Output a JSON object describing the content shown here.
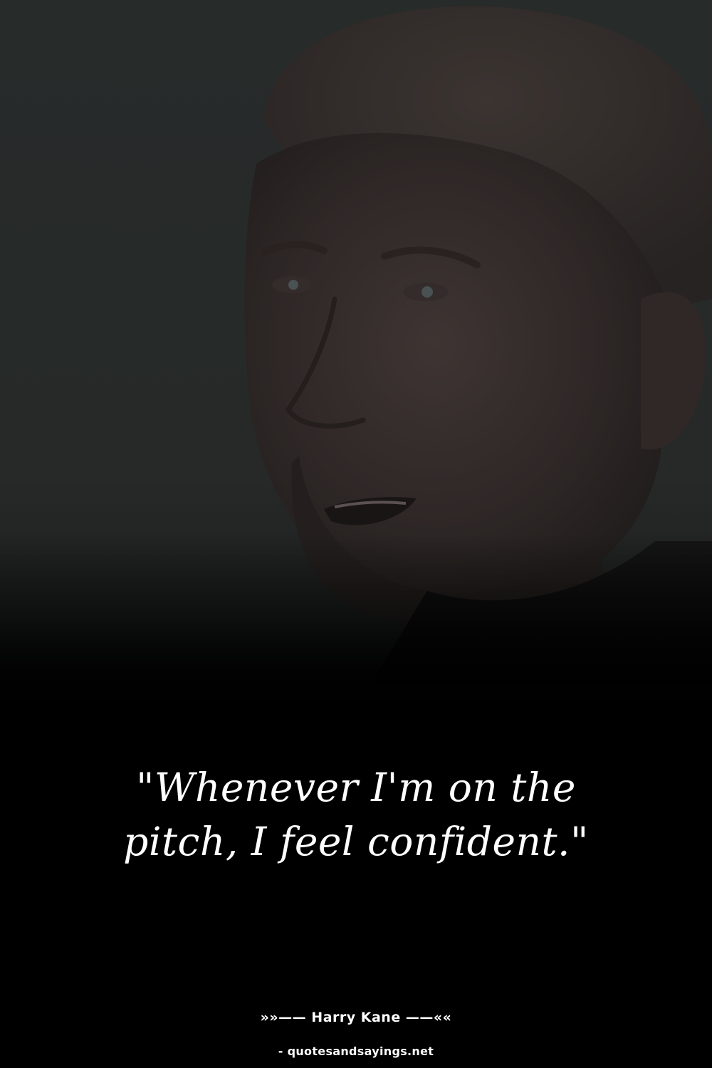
{
  "quote": {
    "text": "\"Whenever I'm on the pitch, I feel confident.\""
  },
  "author": {
    "line": "»»—— Harry Kane ——««"
  },
  "source": {
    "text": "- quotesandsayings.net"
  }
}
